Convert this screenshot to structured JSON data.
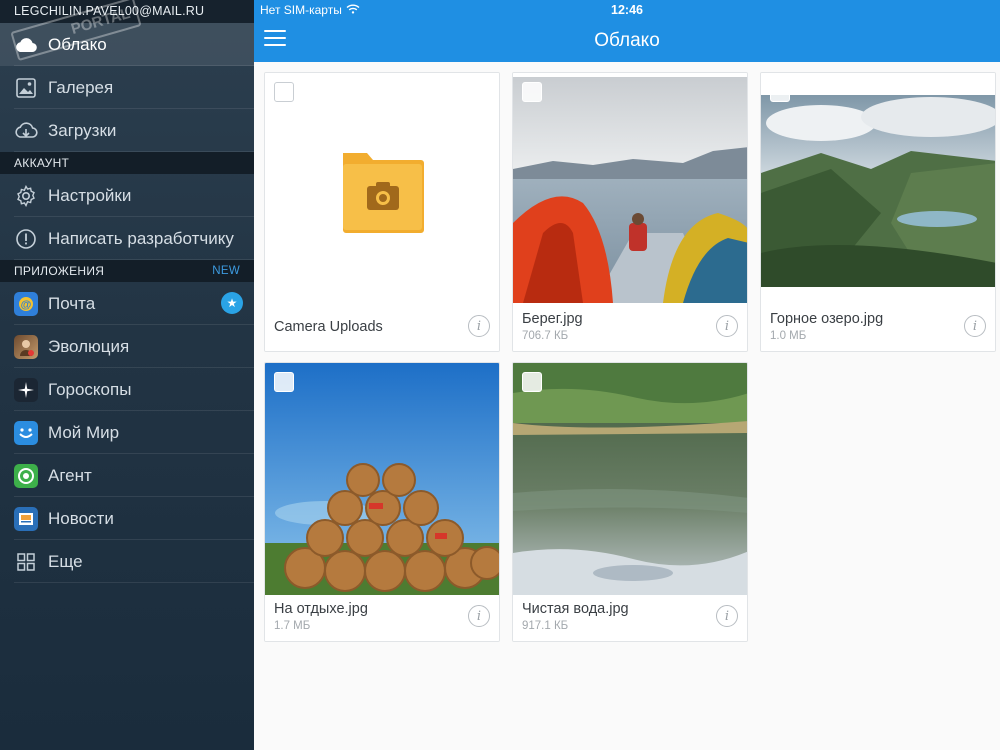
{
  "sidebar": {
    "account_email": "LEGCHILIN.PAVEL00@MAIL.RU",
    "watermark": "PORTAL",
    "main_items": [
      {
        "label": "Облако",
        "icon": "cloud-icon",
        "active": true
      },
      {
        "label": "Галерея",
        "icon": "gallery-icon"
      },
      {
        "label": "Загрузки",
        "icon": "cloud-download-icon"
      }
    ],
    "account_section": {
      "title": "АККАУНТ",
      "items": [
        {
          "label": "Настройки",
          "icon": "gear-icon"
        },
        {
          "label": "Написать разработчику",
          "icon": "exclamation-circle-icon"
        }
      ]
    },
    "apps_section": {
      "title": "ПРИЛОЖЕНИЯ",
      "new_label": "NEW",
      "items": [
        {
          "label": "Почта",
          "icon": "mail-app-icon",
          "color": "#2f7fd9"
        },
        {
          "label": "Эволюция",
          "icon": "evolution-app-icon",
          "color": "#8a5a3a"
        },
        {
          "label": "Гороскопы",
          "icon": "horoscope-app-icon",
          "color": "#1b2633"
        },
        {
          "label": "Мой Мир",
          "icon": "my-world-app-icon",
          "color": "#2b8de0"
        },
        {
          "label": "Агент",
          "icon": "agent-app-icon",
          "color": "#3db04a"
        },
        {
          "label": "Новости",
          "icon": "news-app-icon",
          "color": "#2a6fb8"
        },
        {
          "label": "Еще",
          "icon": "more-grid-icon",
          "color": "#8e9aa5"
        }
      ]
    }
  },
  "status_bar": {
    "carrier": "Нет SIM-карты",
    "time": "12:46"
  },
  "header": {
    "title": "Облако"
  },
  "files": [
    {
      "name": "Camera Uploads",
      "size": "",
      "type": "folder"
    },
    {
      "name": "Берег.jpg",
      "size": "706.7 КБ",
      "type": "photo"
    },
    {
      "name": "Горное озеро.jpg",
      "size": "1.0 МБ",
      "type": "photo"
    },
    {
      "name": "На отдыхе.jpg",
      "size": "1.7 МБ",
      "type": "photo"
    },
    {
      "name": "Чистая вода.jpg",
      "size": "917.1 КБ",
      "type": "photo"
    }
  ],
  "colors": {
    "accent": "#1f8fe3",
    "sidebar_bg": "#223444",
    "folder": "#f5b93a"
  }
}
